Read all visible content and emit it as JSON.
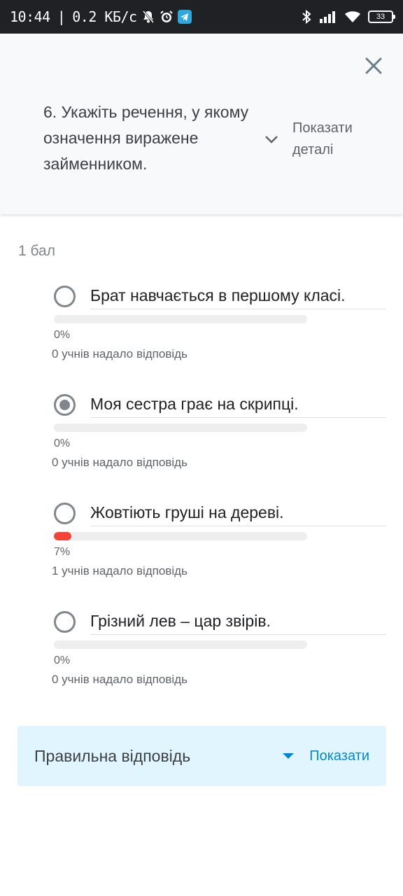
{
  "status_bar": {
    "time": "10:44",
    "separator": "|",
    "net_speed": "0.2 КБ/с",
    "battery": "33"
  },
  "header": {
    "question": "6. Укажіть речення, у якому означення виражене займенником.",
    "details_label": "Показати деталі"
  },
  "points": "1 бал",
  "accent_color": "#f44336",
  "options": [
    {
      "text": "Брат навчається в першому класі.",
      "percent_label": "0%",
      "fraction": 0,
      "responses": "0 учнів надало відповідь",
      "selected": false
    },
    {
      "text": "Моя сестра грає на скрипці.",
      "percent_label": "0%",
      "fraction": 0,
      "responses": "0 учнів надало відповідь",
      "selected": true
    },
    {
      "text": "Жовтіють груші на дереві.",
      "percent_label": "7%",
      "fraction": 0.07,
      "responses": "1 учнів надало відповідь",
      "selected": false
    },
    {
      "text": "Грізний лев – цар звірів.",
      "percent_label": "0%",
      "fraction": 0,
      "responses": "0 учнів надало відповідь",
      "selected": false
    }
  ],
  "correct_answer": {
    "label": "Правильна відповідь",
    "show_label": "Показати"
  }
}
